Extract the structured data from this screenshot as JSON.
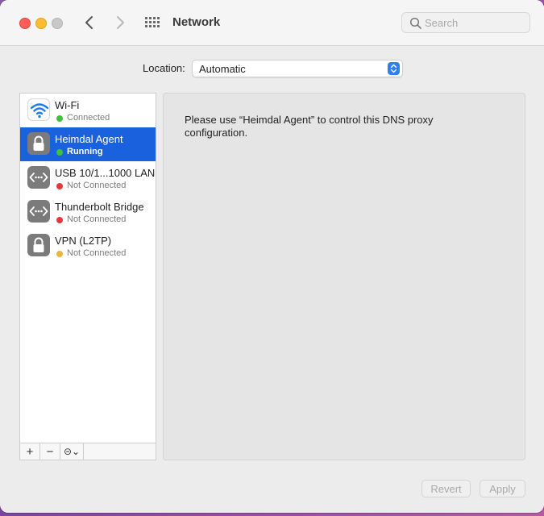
{
  "window": {
    "title": "Network"
  },
  "toolbar": {
    "search_placeholder": "Search"
  },
  "location": {
    "label": "Location:",
    "value": "Automatic"
  },
  "services": [
    {
      "name": "Wi-Fi",
      "status": "Connected",
      "status_color": "#3fc23a",
      "icon": "wifi-icon",
      "selected": false
    },
    {
      "name": "Heimdal Agent",
      "status": "Running",
      "status_color": "#3fc23a",
      "icon": "lock-icon",
      "selected": true
    },
    {
      "name": "USB 10/1...1000 LAN",
      "status": "Not Connected",
      "status_color": "#e5383b",
      "icon": "ethernet-icon",
      "selected": false
    },
    {
      "name": "Thunderbolt Bridge",
      "status": "Not Connected",
      "status_color": "#e5383b",
      "icon": "ethernet-icon",
      "selected": false
    },
    {
      "name": "VPN (L2TP)",
      "status": "Not Connected",
      "status_color": "#f0b43c",
      "icon": "lock-icon",
      "selected": false
    }
  ],
  "sidebar_controls": {
    "add": "+",
    "remove": "−",
    "action": "⊝⌄"
  },
  "detail": {
    "message": "Please use “Heimdal Agent” to control this DNS proxy configuration."
  },
  "buttons": {
    "revert": "Revert",
    "apply": "Apply"
  },
  "colors": {
    "accent": "#1a62dd",
    "connected": "#3fc23a",
    "not_connected": "#e5383b",
    "warning": "#f0b43c"
  }
}
